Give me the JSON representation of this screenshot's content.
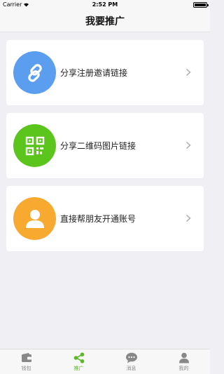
{
  "status_bar": {
    "carrier": "Carrier",
    "time": "2:52 PM"
  },
  "nav": {
    "title": "我要推广"
  },
  "cards": [
    {
      "label": "分享注册邀请链接",
      "icon": "link-icon",
      "color": "#5b9ef0"
    },
    {
      "label": "分享二维码图片链接",
      "icon": "qr-code-icon",
      "color": "#5bc51d"
    },
    {
      "label": "直接帮朋友开通账号",
      "icon": "person-icon",
      "color": "#f7a930"
    }
  ],
  "tabs": [
    {
      "label": "钱包",
      "icon": "wallet-icon",
      "active": false
    },
    {
      "label": "推广",
      "icon": "share-icon",
      "active": true
    },
    {
      "label": "消息",
      "icon": "message-icon",
      "active": false
    },
    {
      "label": "我的",
      "icon": "profile-icon",
      "active": false
    }
  ],
  "colors": {
    "accent": "#5cb82a",
    "background": "#efeff4"
  }
}
